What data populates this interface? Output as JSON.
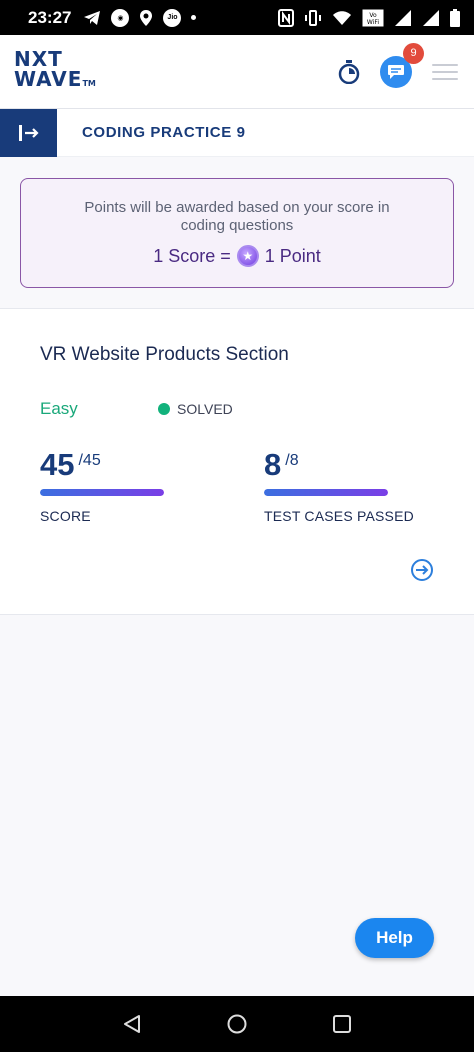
{
  "status_bar": {
    "time": "23:27",
    "carrier_badge": "Jio"
  },
  "header": {
    "logo_line1": "NXT",
    "logo_line2": "WAVE",
    "logo_tm": "TM",
    "notification_count": "9"
  },
  "title_bar": {
    "title": "CODING PRACTICE 9"
  },
  "info": {
    "message": "Points will be awarded based on your score in coding questions",
    "rate_left": "1 Score =",
    "rate_right": "1 Point"
  },
  "question": {
    "title": "VR Website Products Section",
    "difficulty": "Easy",
    "status": "SOLVED",
    "score": "45",
    "score_total": "/45",
    "score_label": "SCORE",
    "score_fraction": 1.0,
    "tests": "8",
    "tests_total": "/8",
    "tests_label": "TEST CASES PASSED",
    "tests_fraction": 1.0
  },
  "help_label": "Help",
  "colors": {
    "brand_navy": "#183b7a",
    "easy_green": "#1aa87a",
    "solved_dot": "#12b27c",
    "help_blue": "#1b86ef",
    "badge_red": "#e24b3c"
  },
  "icons": [
    "telegram-icon",
    "location-icon",
    "jio-icon",
    "nfc-icon",
    "vibrate-icon",
    "wifi-icon",
    "signal-icon",
    "battery-icon",
    "timer-icon",
    "chat-icon",
    "hamburger-icon",
    "sidebar-expand-icon",
    "star-coin-icon",
    "arrow-right-circle-icon",
    "nav-back-icon",
    "nav-home-icon",
    "nav-recents-icon"
  ]
}
